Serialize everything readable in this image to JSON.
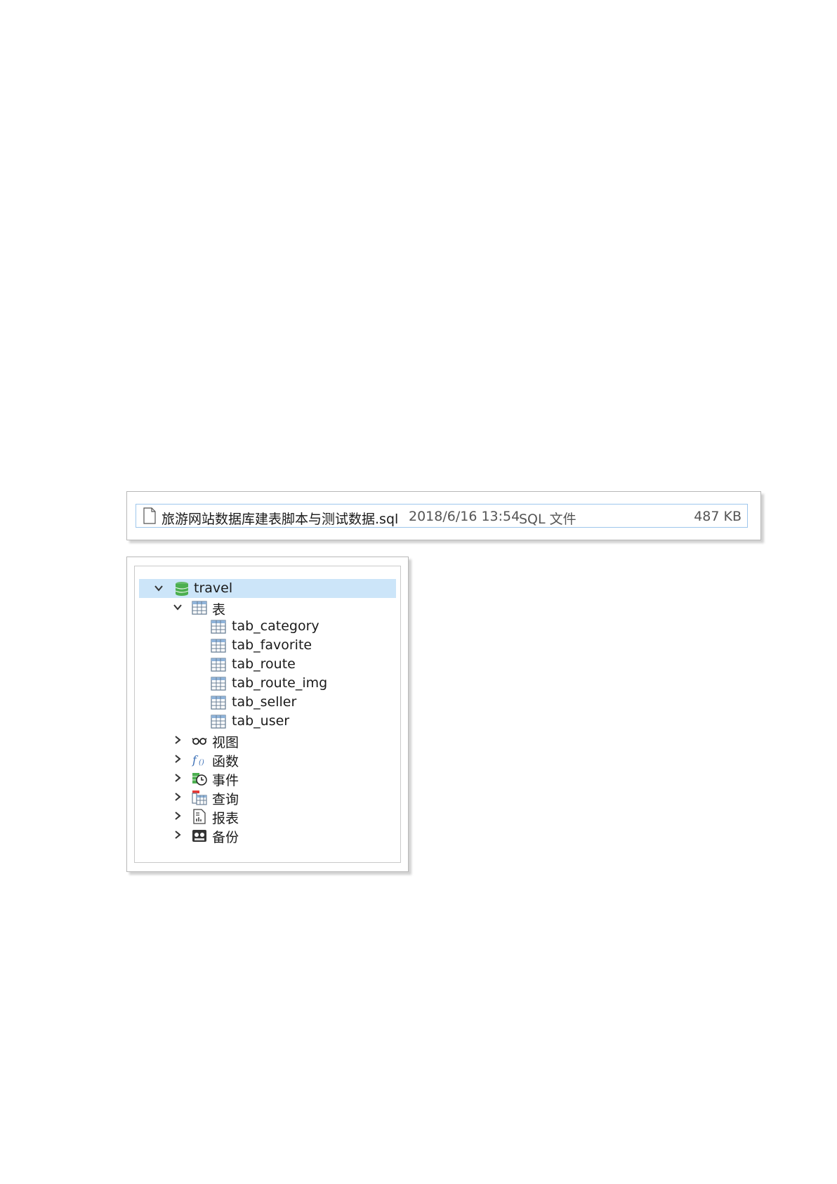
{
  "file": {
    "name": "旅游网站数据库建表脚本与测试数据.sql",
    "date": "2018/6/16 13:54",
    "type": "SQL 文件",
    "size": "487 KB"
  },
  "tree": {
    "database": {
      "label": "travel",
      "icon": "database-icon",
      "expanded": true,
      "selected": true
    },
    "tables_folder": {
      "label": "表",
      "icon": "table-folder-icon",
      "expanded": true
    },
    "tables": [
      "tab_category",
      "tab_favorite",
      "tab_route",
      "tab_route_img",
      "tab_seller",
      "tab_user"
    ],
    "nodes": [
      {
        "label": "视图",
        "icon": "view-icon"
      },
      {
        "label": "函数",
        "icon": "function-icon"
      },
      {
        "label": "事件",
        "icon": "event-icon"
      },
      {
        "label": "查询",
        "icon": "query-icon"
      },
      {
        "label": "报表",
        "icon": "report-icon"
      },
      {
        "label": "备份",
        "icon": "backup-icon"
      }
    ]
  },
  "colors": {
    "selection": "#cce5f9",
    "row_border": "#9ec6ec",
    "db_green": "#4caf50"
  }
}
